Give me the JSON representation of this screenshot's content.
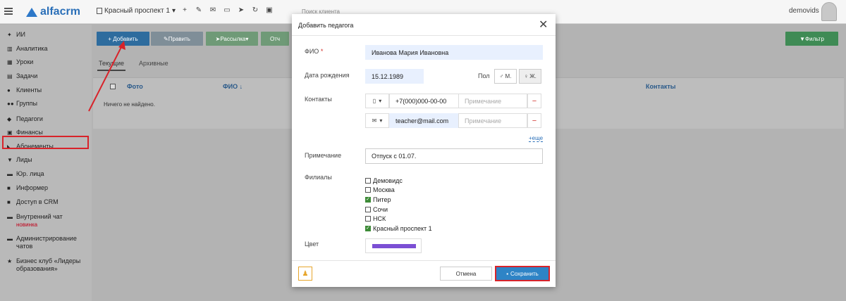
{
  "topbar": {
    "logo_text": "alfacrm",
    "branch": "Красный проспект 1",
    "icons": [
      "plus-icon",
      "wrench-icon",
      "mail-icon",
      "sms-icon",
      "telegram-icon",
      "sync-icon",
      "cart-icon"
    ],
    "search_placeholder": "Поиск клиента",
    "user_name": "demovids"
  },
  "sidebar": {
    "items": [
      {
        "label": "ИИ",
        "icon": "sparkle-icon"
      },
      {
        "label": "Аналитика",
        "icon": "book-icon"
      },
      {
        "label": "Уроки",
        "icon": "calendar-icon"
      },
      {
        "label": "Задачи",
        "icon": "tasks-icon"
      },
      {
        "label": "Клиенты",
        "icon": "user-icon"
      },
      {
        "label": "Группы",
        "icon": "users-icon"
      },
      {
        "label": "Педагоги",
        "icon": "graduation-cap-icon"
      },
      {
        "label": "Финансы",
        "icon": "money-icon"
      },
      {
        "label": "Абонементы",
        "icon": "tag-icon"
      },
      {
        "label": "Лиды",
        "icon": "funnel-icon"
      },
      {
        "label": "Юр. лица",
        "icon": "briefcase-icon"
      },
      {
        "label": "Информер",
        "icon": "bell-icon"
      },
      {
        "label": "Доступ в CRM",
        "icon": "lock-icon"
      },
      {
        "label": "Внутренний чат",
        "icon": "chat-icon",
        "badge": "новинка"
      },
      {
        "label": "Администрирование чатов",
        "icon": "chat-admin-icon"
      },
      {
        "label": "Бизнес клуб «Лидеры образования»",
        "icon": "star-icon"
      }
    ],
    "selected": "Педагоги"
  },
  "toolbar": {
    "add": "+ Добавить",
    "edit": "Править",
    "mailing": "Рассылка",
    "more": "Отч",
    "filter": "Фильтр"
  },
  "tabs": {
    "active": "Текущие",
    "archive": "Архивные"
  },
  "grid": {
    "columns": [
      "Фото",
      "ФИО ↓",
      "Контакты"
    ],
    "empty_text": "Ничего не найдено."
  },
  "modal": {
    "title": "Добавить педагога",
    "fio_label": "ФИО",
    "fio_value": "Иванова Мария Ивановна",
    "birth_label": "Дата рождения",
    "birth_value": "15.12.1989",
    "gender_label": "Пол",
    "gender_m": "М.",
    "gender_f": "Ж.",
    "contacts_label": "Контакты",
    "contacts": [
      {
        "type_icon": "phone-icon",
        "value": "+7(000)000-00-00",
        "note_placeholder": "Примечание"
      },
      {
        "type_icon": "mail-icon",
        "value": "teacher@mail.com",
        "note_placeholder": "Примечание"
      }
    ],
    "more_link": "+еще",
    "note_label": "Примечание",
    "note_value": "Отпуск с 01.07.",
    "branches_label": "Филиалы",
    "branches": [
      {
        "name": "Демовидс",
        "checked": false
      },
      {
        "name": "Москва",
        "checked": false
      },
      {
        "name": "Питер",
        "checked": true
      },
      {
        "name": "Сочи",
        "checked": false
      },
      {
        "name": "НСК",
        "checked": false
      },
      {
        "name": "Красный проспект 1",
        "checked": true
      }
    ],
    "color_label": "Цвет",
    "color_value": "#7b4fd4",
    "cancel": "Отмена",
    "save": "Сохранить"
  },
  "colors": {
    "accent": "#2e84c6",
    "highlight": "#d8232a",
    "check": "#3d8b37"
  }
}
